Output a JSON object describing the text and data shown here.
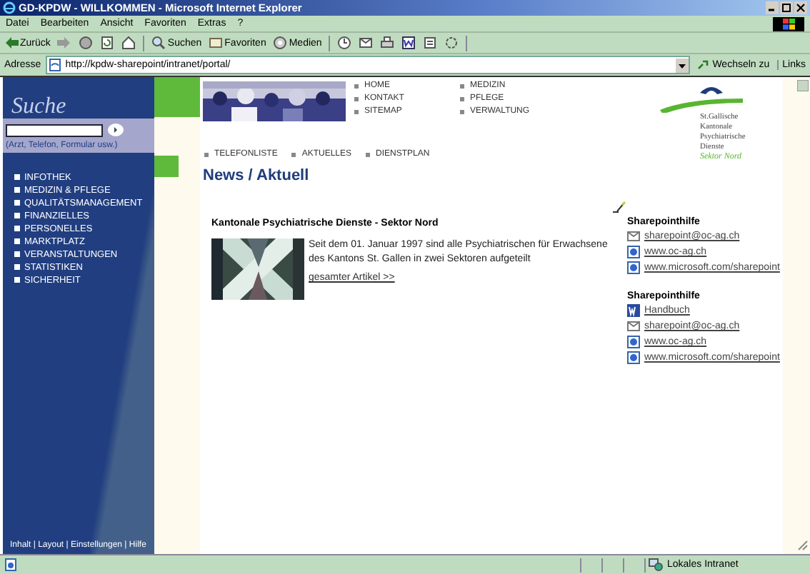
{
  "window": {
    "title": "GD-KPDW - WILLKOMMEN - Microsoft Internet Explorer"
  },
  "menu": [
    "Datei",
    "Bearbeiten",
    "Ansicht",
    "Favoriten",
    "Extras",
    "?"
  ],
  "toolbar": [
    {
      "kind": "back",
      "label": "Zurück"
    },
    {
      "kind": "forward"
    },
    {
      "kind": "stop"
    },
    {
      "kind": "refresh"
    },
    {
      "kind": "home"
    },
    {
      "kind": "search",
      "label": "Suchen"
    },
    {
      "kind": "favorites",
      "label": "Favoriten"
    },
    {
      "kind": "media",
      "label": "Medien"
    },
    {
      "kind": "history"
    },
    {
      "kind": "mail"
    },
    {
      "kind": "print"
    },
    {
      "kind": "edit"
    },
    {
      "kind": "discuss"
    },
    {
      "kind": "messenger"
    }
  ],
  "address": {
    "label": "Adresse",
    "url": "http://kpdw-sharepoint/intranet/portal/",
    "go": "Wechseln zu",
    "links": "Links"
  },
  "sidebar": {
    "search_title": "Suche",
    "search_hint": "(Arzt, Telefon, Formular usw.)",
    "items": [
      "INFOTHEK",
      "MEDIZIN & PFLEGE",
      "QUALITÄTSMANAGEMENT",
      "FINANZIELLES",
      "PERSONELLES",
      "MARKTPLATZ",
      "VERANSTALTUNGEN",
      "STATISTIKEN",
      "SICHERHEIT"
    ],
    "footer": "Inhalt | Layout | Einstellungen | Hilfe"
  },
  "top_nav": [
    [
      "HOME",
      "KONTAKT",
      "SITEMAP"
    ],
    [
      "MEDIZIN",
      "PFLEGE",
      "VERWALTUNG"
    ]
  ],
  "logo": {
    "lines": [
      "St.Gallische",
      "Kantonale",
      "Psychiatrische",
      "Dienste"
    ],
    "sector": "Sektor Nord"
  },
  "sub_nav": [
    "TELEFONLISTE",
    "AKTUELLES",
    "DIENSTPLAN"
  ],
  "news": {
    "title": "News / Aktuell",
    "heading": "Kantonale Psychiatrische Dienste - Sektor Nord",
    "text": "Seit dem 01. Januar 1997 sind alle Psychiatrischen für Erwachsene des Kantons St. Gallen in zwei Sektoren aufgeteilt",
    "link": "gesamter Artikel >>"
  },
  "help_groups": [
    {
      "title": "Sharepointhilfe",
      "links": [
        {
          "kind": "mail",
          "text": "sharepoint@oc-ag.ch"
        },
        {
          "kind": "web",
          "text": "www.oc-ag.ch"
        },
        {
          "kind": "web",
          "text": "www.microsoft.com/sharepoint"
        }
      ]
    },
    {
      "title": "Sharepointhilfe",
      "links": [
        {
          "kind": "word",
          "text": "Handbuch"
        },
        {
          "kind": "mail",
          "text": "sharepoint@oc-ag.ch"
        },
        {
          "kind": "web",
          "text": "www.oc-ag.ch"
        },
        {
          "kind": "web",
          "text": "www.microsoft.com/sharepoint"
        }
      ]
    }
  ],
  "status": {
    "zone": "Lokales Intranet"
  }
}
